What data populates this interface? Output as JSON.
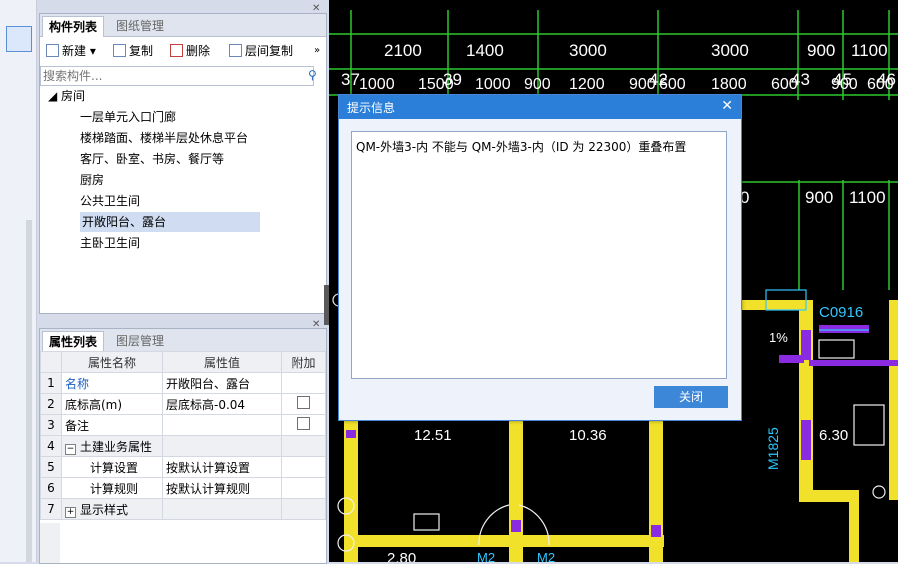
{
  "component_panel": {
    "tabs": [
      "构件列表",
      "图纸管理"
    ],
    "toolbar": {
      "new": "新建",
      "copy": "复制",
      "delete": "删除",
      "floor_copy": "层间复制",
      "more": "»"
    },
    "search_placeholder": "搜索构件...",
    "tree_root": "房间",
    "tree_items": [
      "一层单元入口门廊",
      "楼梯踏面、楼梯半层处休息平台",
      "客厅、卧室、书房、餐厅等",
      "厨房",
      "公共卫生间",
      "开敞阳台、露台",
      "主卧卫生间"
    ],
    "selected_item": "开敞阳台、露台"
  },
  "property_panel": {
    "tabs": [
      "属性列表",
      "图层管理"
    ],
    "headers": [
      "属性名称",
      "属性值",
      "附加"
    ],
    "rows": [
      {
        "num": "1",
        "name": "名称",
        "value": "开敞阳台、露台",
        "has_check": false
      },
      {
        "num": "2",
        "name": "底标高(m)",
        "value": "层底标高-0.04",
        "has_check": true
      },
      {
        "num": "3",
        "name": "备注",
        "value": "",
        "has_check": true
      },
      {
        "num": "4",
        "name": "土建业务属性",
        "value": "",
        "has_check": false
      },
      {
        "num": "5",
        "name": "计算设置",
        "value": "按默认计算设置",
        "has_check": false
      },
      {
        "num": "6",
        "name": "计算规则",
        "value": "按默认计算规则",
        "has_check": false
      },
      {
        "num": "7",
        "name": "显示样式",
        "value": "",
        "has_check": false
      }
    ]
  },
  "cad": {
    "dims_top": [
      "2100",
      "1400",
      "3000",
      "3000",
      "900",
      "1100"
    ],
    "dims_second": [
      "1000",
      "1500",
      "1000",
      "900",
      "1200",
      "900",
      "600",
      "1800",
      "600",
      "900",
      "600"
    ],
    "axis_labels": [
      "37",
      "39",
      "42",
      "43",
      "45",
      "46"
    ],
    "dims_mid": [
      "0",
      "900",
      "1100"
    ],
    "room_labels": [
      "12.51",
      "10.36",
      "6.30",
      "2.80"
    ],
    "tags": [
      "C0916",
      "M1825",
      "1%",
      "M2",
      "M2"
    ]
  },
  "dialog": {
    "title": "提示信息",
    "message": "QM-外墙3-内 不能与 QM-外墙3-内（ID 为 22300）重叠布置",
    "close_label": "关闭"
  }
}
